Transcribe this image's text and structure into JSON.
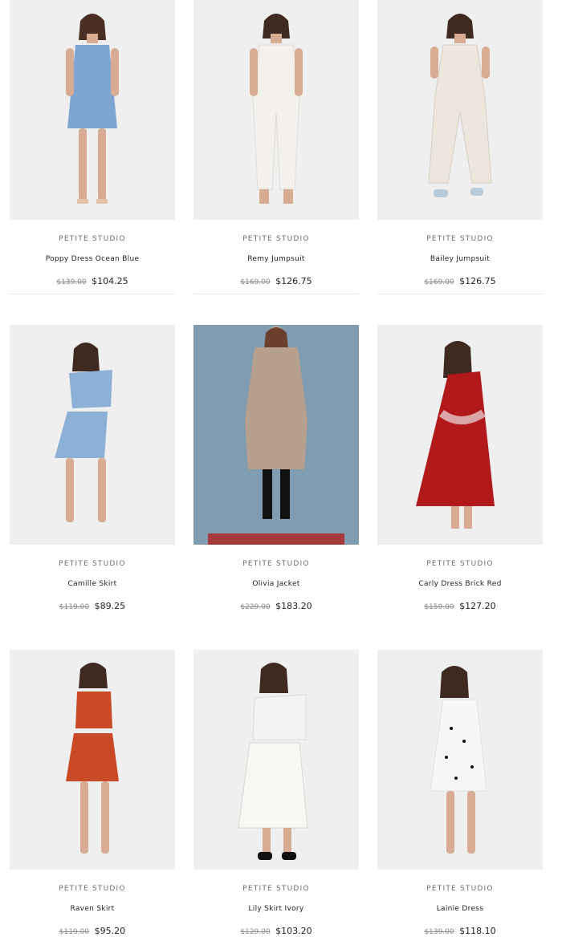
{
  "products": [
    {
      "brand": "PETITE STUDIO",
      "name": "Poppy Dress Ocean Blue",
      "old_price": "$139.00",
      "price": "$104.25"
    },
    {
      "brand": "PETITE STUDIO",
      "name": "Remy Jumpsuit",
      "old_price": "$169.00",
      "price": "$126.75"
    },
    {
      "brand": "PETITE STUDIO",
      "name": "Bailey Jumpsuit",
      "old_price": "$169.00",
      "price": "$126.75"
    },
    {
      "brand": "PETITE STUDIO",
      "name": "Camille Skirt",
      "old_price": "$119.00",
      "price": "$89.25"
    },
    {
      "brand": "PETITE STUDIO",
      "name": "Olivia Jacket",
      "old_price": "$229.00",
      "price": "$183.20"
    },
    {
      "brand": "PETITE STUDIO",
      "name": "Carly Dress Brick Red",
      "old_price": "$159.00",
      "price": "$127.20"
    },
    {
      "brand": "PETITE STUDIO",
      "name": "Raven Skirt",
      "old_price": "$119.00",
      "price": "$95.20"
    },
    {
      "brand": "PETITE STUDIO",
      "name": "Lily Skirt Ivory",
      "old_price": "$129.00",
      "price": "$103.20"
    },
    {
      "brand": "PETITE STUDIO",
      "name": "Lainie Dress",
      "old_price": "$139.00",
      "price": "$118.10"
    }
  ],
  "colors": {
    "text": "#222222",
    "muted": "#6d6d6d",
    "strike": "#8a8a8a",
    "photo_bg": "#efefef",
    "photo_bg_alt": "#7f9cb1"
  }
}
